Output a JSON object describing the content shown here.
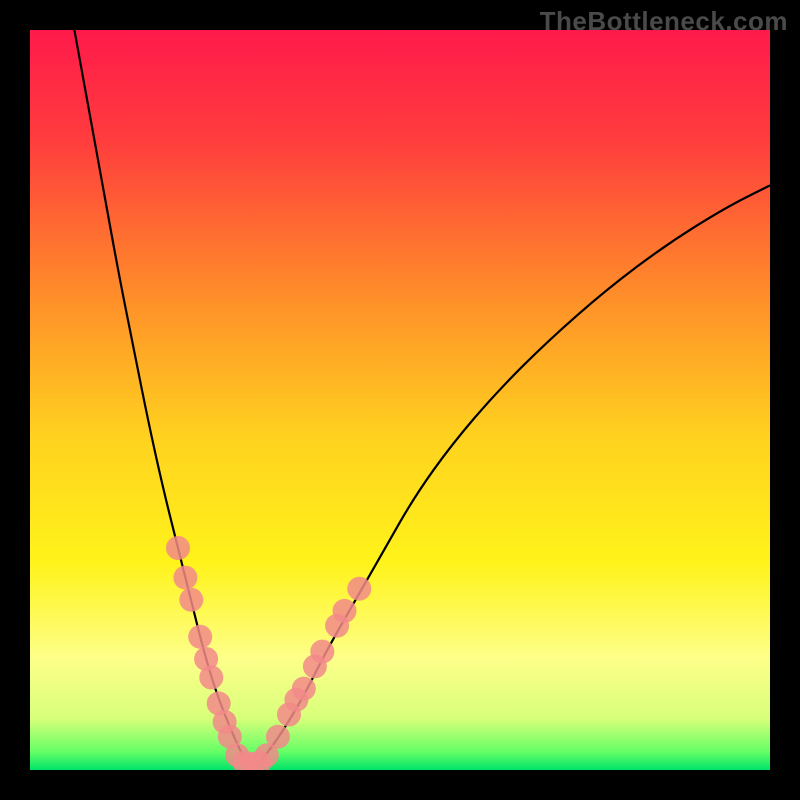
{
  "watermark": "TheBottleneck.com",
  "chart_data": {
    "type": "line",
    "title": "",
    "xlabel": "",
    "ylabel": "",
    "xlim": [
      0,
      100
    ],
    "ylim": [
      0,
      100
    ],
    "grid": false,
    "legend": false,
    "background_gradient_stops": [
      {
        "offset": 0.0,
        "color": "#ff1a4b"
      },
      {
        "offset": 0.15,
        "color": "#ff3d3d"
      },
      {
        "offset": 0.35,
        "color": "#ff8a2a"
      },
      {
        "offset": 0.55,
        "color": "#ffd21f"
      },
      {
        "offset": 0.72,
        "color": "#fff31a"
      },
      {
        "offset": 0.85,
        "color": "#fdff8a"
      },
      {
        "offset": 0.93,
        "color": "#d8ff7a"
      },
      {
        "offset": 0.975,
        "color": "#66ff66"
      },
      {
        "offset": 1.0,
        "color": "#00e46a"
      }
    ],
    "series": [
      {
        "name": "bottleneck-curve",
        "color": "#000000",
        "x": [
          6,
          8,
          10,
          12,
          14,
          16,
          18,
          20,
          22,
          23.5,
          25,
          26.5,
          28,
          29,
          30,
          31.5,
          34,
          37,
          40,
          44,
          48,
          52,
          57,
          63,
          70,
          78,
          86,
          94,
          100
        ],
        "y": [
          100,
          89,
          78,
          67,
          57,
          47,
          38,
          30,
          22,
          16,
          11,
          7,
          3.5,
          1.5,
          0.5,
          1.5,
          5,
          10,
          16,
          23,
          30,
          37,
          44,
          51,
          58,
          65,
          71,
          76,
          79
        ]
      }
    ],
    "markers": {
      "name": "highlighted-points",
      "color": "#f28a8a",
      "radius": 12,
      "points": [
        {
          "x": 20.0,
          "y": 30.0
        },
        {
          "x": 21.0,
          "y": 26.0
        },
        {
          "x": 21.8,
          "y": 23.0
        },
        {
          "x": 23.0,
          "y": 18.0
        },
        {
          "x": 23.8,
          "y": 15.0
        },
        {
          "x": 24.5,
          "y": 12.5
        },
        {
          "x": 25.5,
          "y": 9.0
        },
        {
          "x": 26.3,
          "y": 6.5
        },
        {
          "x": 27.0,
          "y": 4.5
        },
        {
          "x": 28.0,
          "y": 2.0
        },
        {
          "x": 29.0,
          "y": 1.0
        },
        {
          "x": 30.0,
          "y": 0.8
        },
        {
          "x": 31.0,
          "y": 1.0
        },
        {
          "x": 32.0,
          "y": 2.0
        },
        {
          "x": 33.5,
          "y": 4.5
        },
        {
          "x": 35.0,
          "y": 7.5
        },
        {
          "x": 36.0,
          "y": 9.5
        },
        {
          "x": 37.0,
          "y": 11.0
        },
        {
          "x": 38.5,
          "y": 14.0
        },
        {
          "x": 39.5,
          "y": 16.0
        },
        {
          "x": 41.5,
          "y": 19.5
        },
        {
          "x": 42.5,
          "y": 21.5
        },
        {
          "x": 44.5,
          "y": 24.5
        }
      ]
    }
  }
}
